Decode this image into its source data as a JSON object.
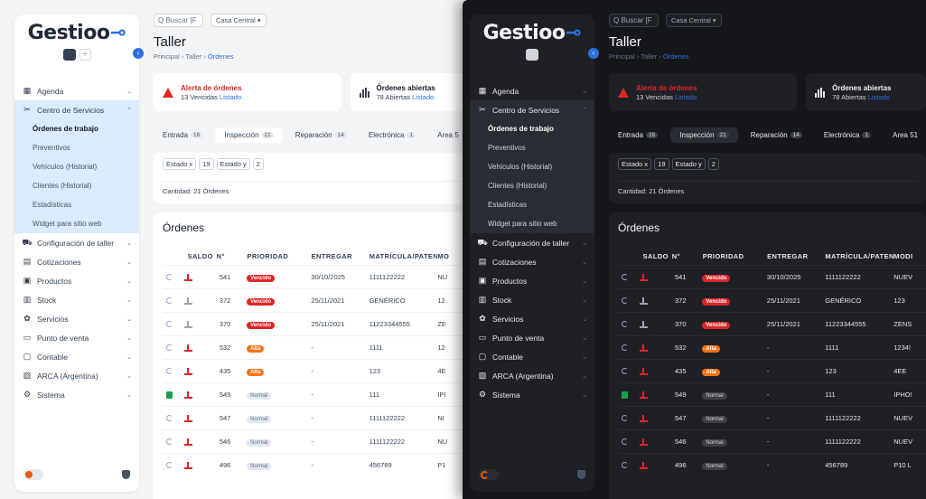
{
  "app": {
    "logo": "Gestioo",
    "logo_key": "⊸"
  },
  "sidebar": {
    "items": [
      {
        "label": "Agenda",
        "icon": "calendar-icon"
      },
      {
        "label": "Centro de Servicios",
        "icon": "tools-icon",
        "open": true
      },
      {
        "label": "Configuración de taller",
        "icon": "car-icon"
      },
      {
        "label": "Cotizaciones",
        "icon": "document-icon"
      },
      {
        "label": "Productos",
        "icon": "box-icon"
      },
      {
        "label": "Stock",
        "icon": "shelves-icon"
      },
      {
        "label": "Servicios",
        "icon": "services-icon"
      },
      {
        "label": "Punto de venta",
        "icon": "register-icon"
      },
      {
        "label": "Contable",
        "icon": "monitor-icon"
      },
      {
        "label": "ARCA (Argentina)",
        "icon": "receipt-icon"
      },
      {
        "label": "Sistema",
        "icon": "gear-icon"
      }
    ],
    "subitems": [
      "Órdenes de trabajo",
      "Preventivos",
      "Vehículos (Historial)",
      "Clientes (Historial)",
      "Estadísticas",
      "Widget para sitio web"
    ]
  },
  "topbar": {
    "search_placeholder": "Buscar [F",
    "branch": "Casa Central ▾"
  },
  "page": {
    "title": "Taller",
    "breadcrumb": [
      "Principal",
      "Taller",
      "Órdenes"
    ]
  },
  "alerts": {
    "a1": {
      "title": "Alerta de órdenes",
      "count": "13 Vencidas",
      "link": "Listado"
    },
    "a2": {
      "title": "Órdenes abiertas",
      "count": "78 Abiertas",
      "link": "Listado"
    }
  },
  "tabs": [
    {
      "label": "Entrada",
      "count": "16"
    },
    {
      "label": "Inspección",
      "count": "21",
      "active": true
    },
    {
      "label": "Reparación",
      "count": "14"
    },
    {
      "label": "Electrónica",
      "count": "1"
    },
    {
      "label": "Area 5",
      "count": ""
    }
  ],
  "tabs_dark_last": {
    "label": "Area 51",
    "count": ""
  },
  "filters": {
    "chips": [
      "Estado x",
      "19",
      "Estado y",
      "2"
    ],
    "count_text": "Cantidad: 21 Órdenes"
  },
  "orders": {
    "title": "Órdenes",
    "headers": {
      "saldo": "SALDO",
      "n": "N°",
      "prioridad": "PRIORIDAD",
      "entregar": "ENTREGAR",
      "matricula": "MATRÍCULA/PATENTE",
      "modelo": "MO"
    },
    "headers_dark_modelo": "MODI",
    "rows": [
      {
        "n": "541",
        "prioridad": "Vencido",
        "entregar": "30/10/2025",
        "matricula": "1111122222",
        "modelo": "NU",
        "modelo_dark": "NUEV",
        "lock": false,
        "saldo": "red"
      },
      {
        "n": "372",
        "prioridad": "Vencido",
        "entregar": "25/11/2021",
        "matricula": "GENÉRICO",
        "modelo": "12",
        "modelo_dark": "123",
        "lock": false,
        "saldo": "muted"
      },
      {
        "n": "370",
        "prioridad": "Vencido",
        "entregar": "25/11/2021",
        "matricula": "11223344555",
        "modelo": "ZE",
        "modelo_dark": "ZENS",
        "lock": false,
        "saldo": "muted"
      },
      {
        "n": "532",
        "prioridad": "Alta",
        "entregar": "-",
        "matricula": "1111",
        "modelo": "12",
        "modelo_dark": "1234!",
        "lock": false,
        "saldo": "red"
      },
      {
        "n": "435",
        "prioridad": "Alta",
        "entregar": "-",
        "matricula": "123",
        "modelo": "4E",
        "modelo_dark": "4EE",
        "lock": false,
        "saldo": "red"
      },
      {
        "n": "549",
        "prioridad": "Normal",
        "entregar": "-",
        "matricula": "111",
        "modelo": "IPI",
        "modelo_dark": "IPHO!",
        "lock": true,
        "saldo": "red"
      },
      {
        "n": "547",
        "prioridad": "Normal",
        "entregar": "-",
        "matricula": "1111122222",
        "modelo": "NI",
        "modelo_dark": "NUEV",
        "lock": false,
        "saldo": "red"
      },
      {
        "n": "546",
        "prioridad": "Normal",
        "entregar": "-",
        "matricula": "1111122222",
        "modelo": "NU",
        "modelo_dark": "NUEV",
        "lock": false,
        "saldo": "red"
      },
      {
        "n": "496",
        "prioridad": "Normal",
        "entregar": "-",
        "matricula": "456789",
        "modelo": "P1",
        "modelo_dark": "P10 L",
        "lock": false,
        "saldo": "red"
      }
    ]
  },
  "colors": {
    "accent": "#2f6fde",
    "danger": "#dc2626",
    "warning": "#f97316",
    "ok": "#16a34a"
  }
}
